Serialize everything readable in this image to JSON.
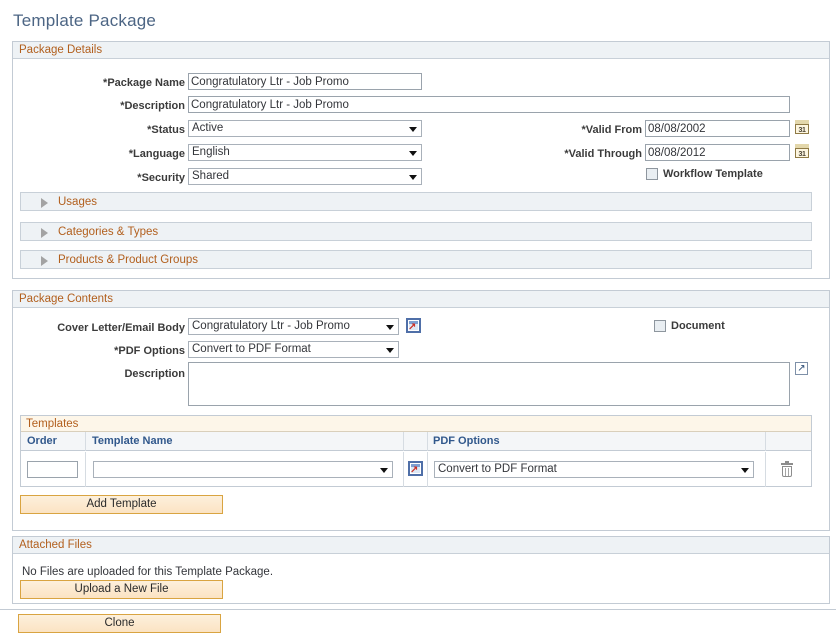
{
  "page": {
    "title": "Template Package"
  },
  "package_details": {
    "header": "Package Details",
    "fields": {
      "package_name_label": "*Package Name",
      "package_name_value": "Congratulatory Ltr - Job Promo",
      "description_label": "*Description",
      "description_value": "Congratulatory Ltr - Job Promo",
      "status_label": "*Status",
      "status_value": "Active",
      "language_label": "*Language",
      "language_value": "English",
      "security_label": "*Security",
      "security_value": "Shared",
      "valid_from_label": "*Valid From",
      "valid_from_value": "08/08/2002",
      "valid_through_label": "*Valid Through",
      "valid_through_value": "08/08/2012",
      "workflow_template_label": "Workflow Template",
      "calendar_icon_glyph": "31"
    }
  },
  "collapsibles": [
    {
      "label": "Usages"
    },
    {
      "label": "Categories & Types"
    },
    {
      "label": "Products & Product Groups"
    }
  ],
  "package_contents": {
    "header": "Package Contents",
    "cover_letter_label": "Cover Letter/Email Body",
    "cover_letter_value": "Congratulatory Ltr - Job Promo",
    "pdf_options_label": "*PDF Options",
    "pdf_options_value": "Convert to PDF Format",
    "description_label": "Description",
    "description_value": "",
    "document_checkbox_label": "Document",
    "expand_icon_glyph": "↗",
    "prompt_icon_glyph": "↗"
  },
  "templates_grid": {
    "header": "Templates",
    "columns": [
      "Order",
      "Template Name",
      "",
      "PDF Options",
      ""
    ],
    "rows": [
      {
        "order": "",
        "template_name": "",
        "pdf_options": "Convert to PDF Format"
      }
    ],
    "add_button_label": "Add Template"
  },
  "attached_files": {
    "header": "Attached Files",
    "empty_message": "No Files are uploaded for this Template Package.",
    "upload_button_label": "Upload a New File"
  },
  "footer": {
    "clone_button_label": "Clone"
  },
  "colors": {
    "title": "#4c6584",
    "section_header_text": "#b25f1d",
    "section_header_bg": "#eef2f5",
    "grid_column_header": "#31588c",
    "button_border": "#d9a441",
    "panel_border": "#c3cbd4"
  }
}
